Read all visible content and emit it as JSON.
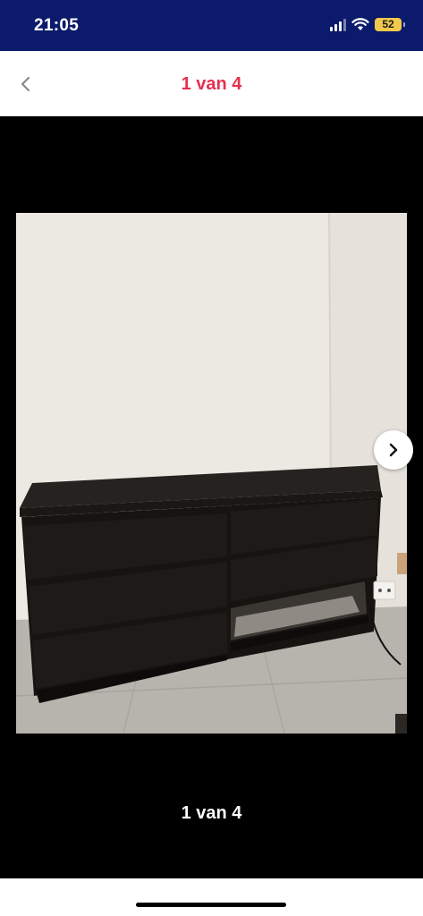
{
  "status_bar": {
    "time": "21:05",
    "battery": "52",
    "icons": [
      "signal-icon",
      "wifi-icon",
      "battery-icon"
    ]
  },
  "nav": {
    "title": "1 van 4",
    "back_icon": "chevron-left-icon",
    "title_color": "#e5304f"
  },
  "gallery": {
    "counter": "1 van 4",
    "next_icon": "chevron-right-icon",
    "photo_subject": "dresser-photo"
  },
  "colors": {
    "status_bar_bg": "#0b1a6b",
    "accent": "#e5304f",
    "viewer_bg": "#000000"
  }
}
